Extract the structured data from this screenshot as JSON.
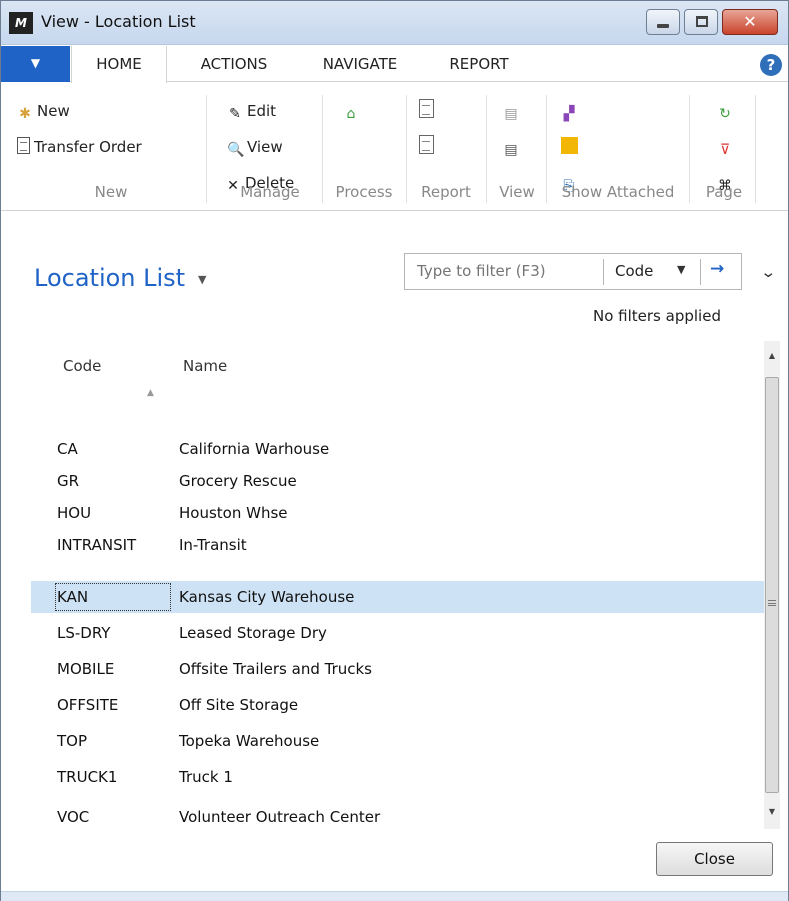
{
  "window": {
    "title": "View - Location List",
    "logo": "M",
    "close_glyph": "✕"
  },
  "ribbon_tabs": [
    {
      "label": "HOME"
    },
    {
      "label": "ACTIONS"
    },
    {
      "label": "NAVIGATE"
    },
    {
      "label": "REPORT"
    }
  ],
  "help_icon": "?",
  "ribbon": {
    "new_group": {
      "label": "New",
      "buttons": [
        "New",
        "Transfer Order"
      ]
    },
    "manage_group": {
      "label": "Manage",
      "buttons": [
        "Edit",
        "View",
        "Delete"
      ]
    },
    "process_group": {
      "label": "Process"
    },
    "report_group": {
      "label": "Report"
    },
    "view_group": {
      "label": "View"
    },
    "show_attached_group": {
      "label": "Show Attached"
    },
    "page_group": {
      "label": "Page"
    }
  },
  "page": {
    "title": "Location List",
    "filter_placeholder": "Type to filter (F3)",
    "filter_field": "Code",
    "filter_status": "No filters applied"
  },
  "table": {
    "columns": [
      "Code",
      "Name"
    ],
    "rows": [
      {
        "code": "CA",
        "name": "California Warhouse"
      },
      {
        "code": "GR",
        "name": "Grocery Rescue"
      },
      {
        "code": "HOU",
        "name": "Houston Whse"
      },
      {
        "code": "INTRANSIT",
        "name": "In-Transit"
      },
      {
        "code": "KAN",
        "name": "Kansas City Warehouse"
      },
      {
        "code": "LS-DRY",
        "name": "Leased Storage Dry"
      },
      {
        "code": "MOBILE",
        "name": "Offsite Trailers and Trucks"
      },
      {
        "code": "OFFSITE",
        "name": "Off Site Storage"
      },
      {
        "code": "TOP",
        "name": "Topeka Warehouse"
      },
      {
        "code": "TRUCK1",
        "name": "Truck 1"
      },
      {
        "code": "VOC",
        "name": "Volunteer Outreach Center"
      }
    ],
    "selected_code": "KAN"
  },
  "footer": {
    "close_label": "Close"
  },
  "colors": {
    "accent": "#1f63c6",
    "selected_row": "#cde2f4"
  }
}
